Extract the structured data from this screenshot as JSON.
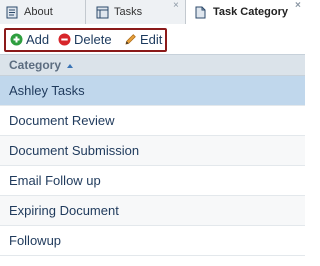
{
  "tabs": [
    {
      "label": "About",
      "close": "×"
    },
    {
      "label": "Tasks",
      "close": "×"
    },
    {
      "label": "Task Category",
      "close": "×"
    }
  ],
  "toolbar": {
    "add_label": "Add",
    "delete_label": "Delete",
    "edit_label": "Edit"
  },
  "grid": {
    "column_header": "Category",
    "rows": [
      "Ashley Tasks",
      "Document Review",
      "Document Submission",
      "Email Follow up",
      "Expiring Document",
      "Followup"
    ],
    "selected_row": "Ashley Tasks"
  },
  "colors": {
    "toolbar_border": "#8b1a1a",
    "add_icon": "#2e9e3f",
    "delete_icon": "#d7262b",
    "edit_icon": "#e8a23b",
    "selected_row": "#c0d7ec",
    "header_bg": "#dbe3ea"
  }
}
